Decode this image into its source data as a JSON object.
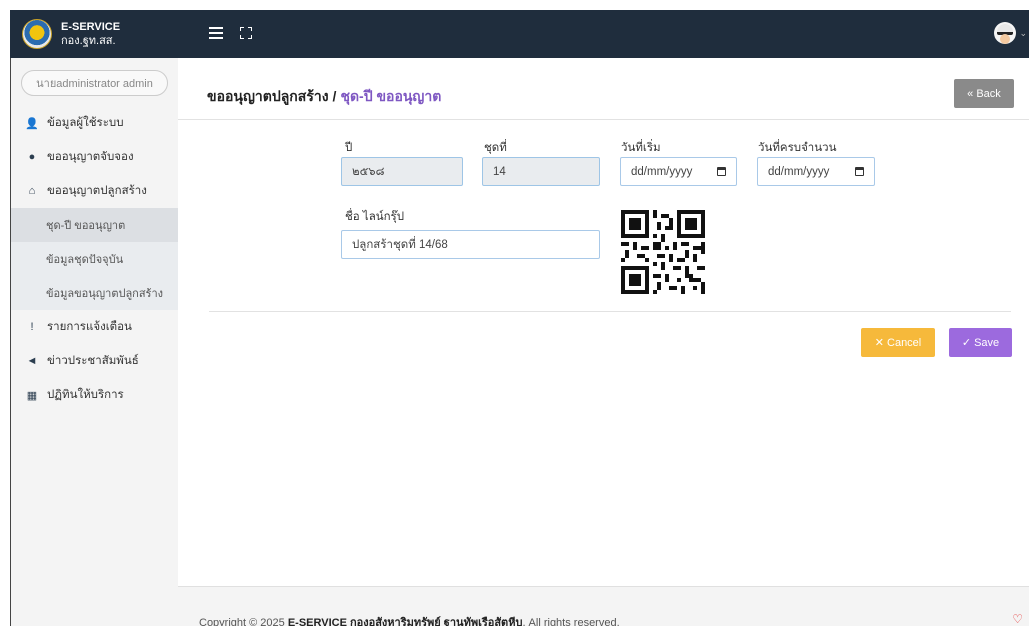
{
  "brand": {
    "title": "E-SERVICE",
    "subtitle": "กอง.ฐท.สส."
  },
  "sidebar": {
    "user_name": "นายadministrator admin",
    "items": [
      {
        "label": "ข้อมูลผู้ใช้ระบบ",
        "icon": "user-tie-icon"
      },
      {
        "label": "ขออนุญาตจับจอง",
        "icon": "map-marker-icon"
      },
      {
        "label": "ขออนุญาตปลูกสร้าง",
        "icon": "home-icon"
      },
      {
        "label": "รายการแจ้งเตือน",
        "icon": "exclamation-circle-icon"
      },
      {
        "label": "ข่าวประชาสัมพันธ์",
        "icon": "bullhorn-icon"
      },
      {
        "label": "ปฏิทินให้บริการ",
        "icon": "calendar-icon"
      }
    ],
    "sub_items": [
      {
        "label": "ชุด-ปี ขออนุญาต",
        "active": true
      },
      {
        "label": "ข้อมูลชุดปัจจุบัน",
        "active": false
      },
      {
        "label": "ข้อมูลขอนุญาตปลูกสร้าง",
        "active": false
      }
    ]
  },
  "header": {
    "title": "ขออนุญาตปลูกสร้าง",
    "separator": "/",
    "subtitle": "ชุด-ปี ขออนุญาต",
    "back_label": "« Back"
  },
  "form": {
    "year_label": "ปี",
    "year_value": "๒๕๖๘",
    "set_label": "ชุดที่",
    "set_value": "14",
    "start_label": "วันที่เริ่ม",
    "start_placeholder": "dd/mm/yyyy",
    "end_label": "วันที่ครบจำนวน",
    "end_placeholder": "dd/mm/yyyy",
    "group_label": "ชื่อ ไลน์กรุ๊ป",
    "group_value": "ปลูกสร้าชุดที่ 14/68"
  },
  "actions": {
    "cancel_label": "✕ Cancel",
    "save_label": "✓ Save"
  },
  "footer": {
    "prefix": "Copyright © 2025 ",
    "brand": "E-SERVICE กองอสังหาริมทรัพย์ ฐานทัพเรือสัตหีบ",
    "suffix": ", All rights reserved."
  },
  "colors": {
    "topbar": "#1f2d3d",
    "accent_purple": "#7e57c2",
    "cancel": "#f6b93b",
    "save": "#9c6ade",
    "back": "#8a8a8a"
  }
}
